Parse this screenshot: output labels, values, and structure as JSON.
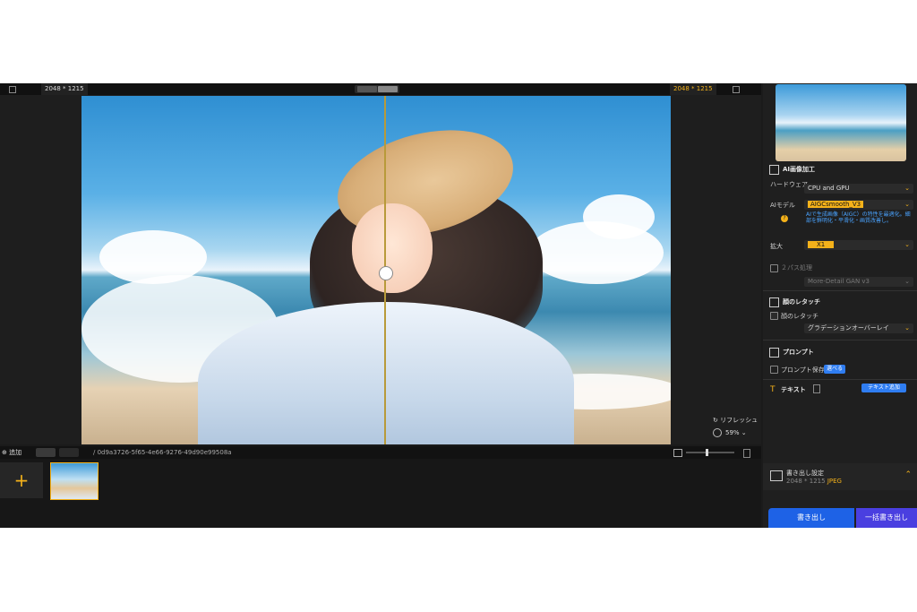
{
  "topbar": {
    "dim_left": "2048 * 1215",
    "dim_right": "2048 * 1215"
  },
  "canvas": {
    "refresh_label": "リフレッシュ",
    "zoom_label": "59%"
  },
  "filmbar": {
    "add_label": "追加",
    "filename": "/ 0d9a3726-5f65-4e66-9276-49d90e99508a"
  },
  "sidebar": {
    "ai_section_title": "AI画像加工",
    "hardware_label": "ハードウェア",
    "hardware_value": "CPU and GPU",
    "model_label": "AIモデル",
    "model_value": "AIGCsmooth_V3",
    "model_note": "AIで生成画像（AIGC）の特性を最適化。細部を鮮明化・平滑化・画質改善し。",
    "scale_label": "拡大",
    "scale_value": "X1",
    "twopass_label": "２パス処理",
    "twopass_value": "More-Detail GAN v3",
    "face_section_title": "顔のレタッチ",
    "face_check_label": "顔のレタッチ",
    "face_value": "グラデーションオーバーレイ",
    "prompt_section_title": "プロンプト",
    "prompt_save_label": "プロンプト保存",
    "prompt_button": "選べる",
    "text_section_title": "テキスト",
    "text_add_button": "テキスト追加",
    "export_title": "書き出し設定",
    "export_dim": "2048 * 1215",
    "export_format": "JPEG",
    "export_button": "書き出し",
    "batch_export_button": "一括書き出し"
  },
  "colors": {
    "accent": "#f5b21a",
    "primary_blue": "#1e62e6",
    "batch_purple": "#4a3fe0"
  }
}
